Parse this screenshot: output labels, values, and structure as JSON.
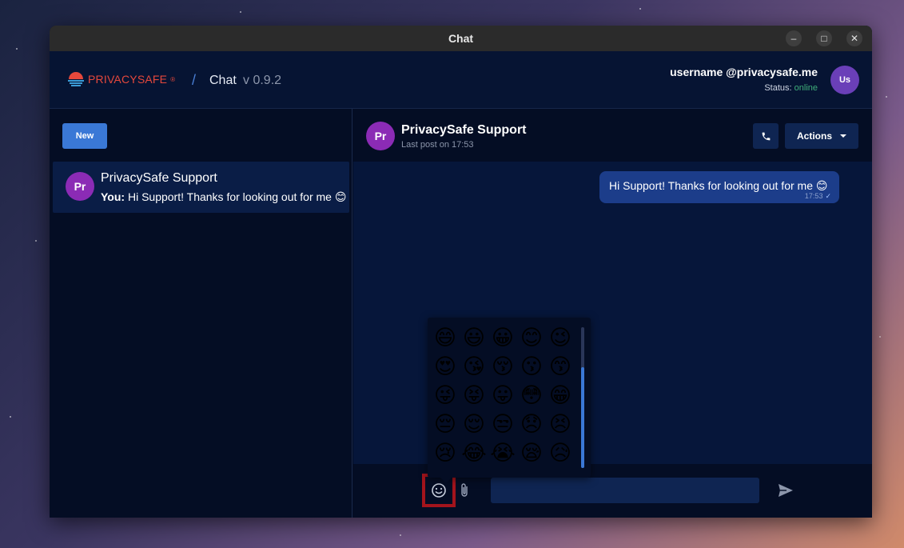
{
  "window": {
    "title": "Chat",
    "controls": [
      "–",
      "□",
      "✕"
    ]
  },
  "header": {
    "brand": "PRIVACYSAFE",
    "registered": "®",
    "separator": "/",
    "app_name": "Chat",
    "version": "v 0.9.2",
    "user": {
      "name": "username @privacysafe.me",
      "status_label": "Status:",
      "status_value": "online",
      "avatar_initials": "Us",
      "avatar_color": "#6a3fb8"
    }
  },
  "sidebar": {
    "new_label": "New",
    "conversations": [
      {
        "avatar_initials": "Pr",
        "name": "PrivacySafe Support",
        "preview_prefix": "You:",
        "preview_text": " Hi Support! Thanks for looking out for me 😊"
      }
    ]
  },
  "chat": {
    "avatar_initials": "Pr",
    "name": "PrivacySafe Support",
    "last_post": "Last post on 17:53",
    "actions_label": "Actions",
    "messages": [
      {
        "text": "Hi Support! Thanks for looking out for me 😊",
        "time": "17:53",
        "tick": "✓"
      }
    ]
  },
  "emoji_picker": {
    "emojis": [
      "😄",
      "😃",
      "😀",
      "😊",
      "😉",
      "😍",
      "😘",
      "😚",
      "😗",
      "😙",
      "😜",
      "😝",
      "😛",
      "😳",
      "😁",
      "😔",
      "😌",
      "😒",
      "😞",
      "😣",
      "😢",
      "😂",
      "😭",
      "😪",
      "😥"
    ]
  },
  "composer": {
    "placeholder": ""
  },
  "colors": {
    "accent": "#3a78d6",
    "highlight_box": "#a3141c",
    "brand": "#e5483c",
    "online": "#3fae7a"
  }
}
